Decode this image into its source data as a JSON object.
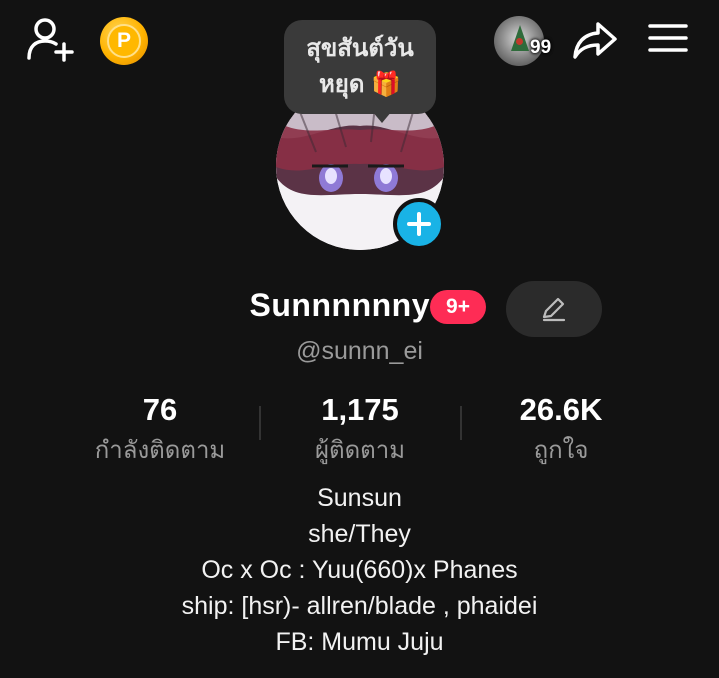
{
  "header": {
    "icons": {
      "add_friend": "add-friend-icon",
      "coins": "coin-icon",
      "share": "share-icon",
      "menu": "menu-icon"
    },
    "coin_label": "P",
    "visitor_count": "99"
  },
  "bubble": {
    "line1": "สุขสันต์วัน",
    "line2": "หยุด 🎁"
  },
  "profile": {
    "name": "Sunnnnnny",
    "badge": "9+",
    "handle": "@sunnn_ei"
  },
  "stats": [
    {
      "value": "76",
      "label": "กำลังติดตาม"
    },
    {
      "value": "1,175",
      "label": "ผู้ติดตาม"
    },
    {
      "value": "26.6K",
      "label": "ถูกใจ"
    }
  ],
  "bio": [
    "Sunsun",
    "she/They",
    "Oc x Oc : Yuu(660)x Phanes",
    "ship: [hsr)- allren/blade , phaidei",
    "FB: Mumu Juju"
  ],
  "colors": {
    "background": "#121212",
    "accent_pink": "#fe2c55",
    "add_blue": "#19b3e6",
    "coin_gold": "#ffb300",
    "muted_text": "#9a9a9a"
  }
}
